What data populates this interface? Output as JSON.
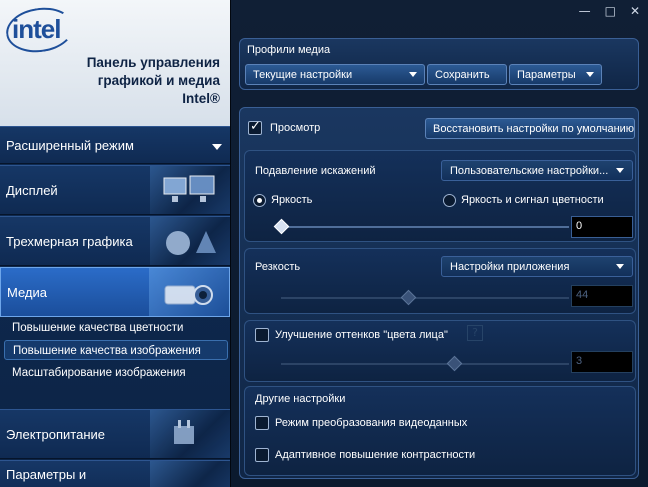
{
  "brand": {
    "logo": "intel",
    "title_line1": "Панель управления",
    "title_line2": "графикой и медиа",
    "title_line3": "Intel®"
  },
  "sidebar": {
    "mode_label": "Расширенный режим",
    "items": [
      {
        "label": "Дисплей",
        "icon": "monitors-icon"
      },
      {
        "label": "Трехмерная графика",
        "icon": "3d-shapes-icon"
      },
      {
        "label": "Медиа",
        "icon": "video-camera-icon",
        "active": true
      },
      {
        "label": "Электропитание",
        "icon": "power-plug-icon"
      },
      {
        "label": "Параметры и",
        "icon": "settings-icon"
      }
    ],
    "sub_items": [
      "Повышение качества цветности",
      "Повышение качества изображения",
      "Масштабирование изображения"
    ],
    "selected_sub_item": 1
  },
  "window_controls": {
    "minimize": "—",
    "maximize": "□",
    "close": "✕"
  },
  "profiles": {
    "title": "Профили медиа",
    "current": "Текущие настройки",
    "save": "Сохранить",
    "params": "Параметры"
  },
  "preview": {
    "label": "Просмотр",
    "checked": true,
    "restore_defaults": "Восстановить настройки по умолчанию"
  },
  "noise": {
    "label": "Подавление искажений",
    "select": "Пользовательские настройки...",
    "radio_brightness": "Яркость",
    "radio_brightness_color": "Яркость и сигнал цветности",
    "value": "0",
    "level": 0
  },
  "sharpness": {
    "label": "Резкость",
    "select": "Настройки приложения",
    "value": "44",
    "level": 0.44
  },
  "skin_tone": {
    "label": "Улучшение оттенков \"цвета лица\"",
    "checked": false,
    "value": "3",
    "level": 0.6
  },
  "other": {
    "title": "Другие настройки",
    "video_mode": "Режим преобразования видеоданных",
    "adaptive_contrast": "Адаптивное повышение контрастности"
  },
  "colors": {
    "accent": "#2b6cc8",
    "panel": "#1a3760",
    "background": "#0b1a2e"
  }
}
